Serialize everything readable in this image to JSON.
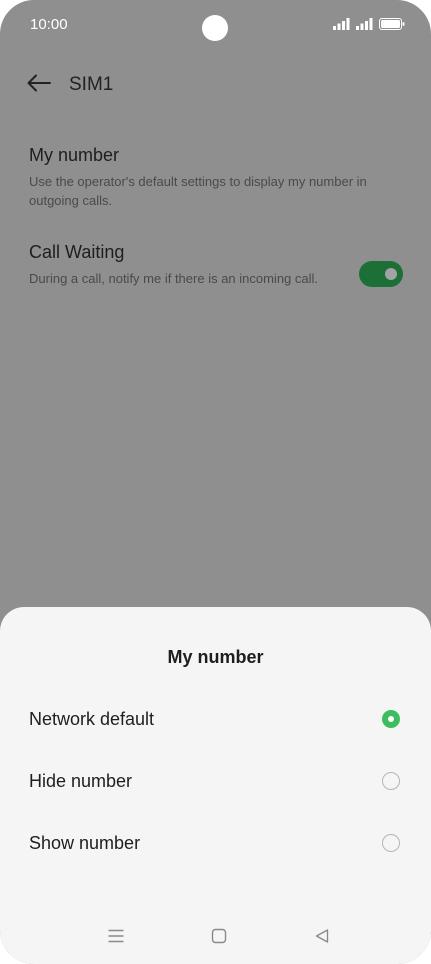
{
  "status_bar": {
    "time": "10:00",
    "icons": [
      "signal-icon",
      "signal-icon",
      "battery-icon"
    ]
  },
  "header": {
    "back_icon": "arrow-left-icon",
    "title": "SIM1"
  },
  "settings": {
    "my_number": {
      "title": "My number",
      "description": "Use the operator's default settings to display my number in outgoing calls."
    },
    "call_waiting": {
      "title": "Call Waiting",
      "description": "During a call, notify me if there is an incoming call.",
      "enabled": true
    }
  },
  "sheet": {
    "title": "My number",
    "options": [
      {
        "label": "Network default",
        "selected": true
      },
      {
        "label": "Hide number",
        "selected": false
      },
      {
        "label": "Show number",
        "selected": false
      }
    ]
  },
  "navbar": {
    "icons": [
      "menu-icon",
      "home-icon",
      "back-icon"
    ]
  },
  "colors": {
    "accent": "#3dbe5e",
    "toggle_on": "#1d6f38",
    "dim_overlay": "#8f8f8f"
  }
}
